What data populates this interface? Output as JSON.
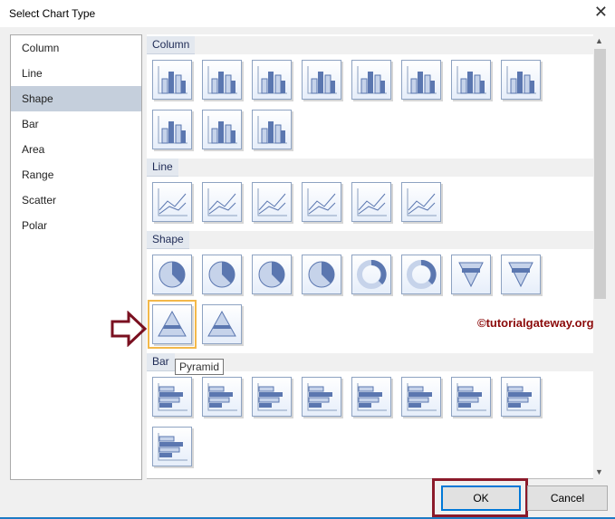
{
  "dialog": {
    "title": "Select Chart Type",
    "close_icon": "close-icon"
  },
  "categories": [
    "Column",
    "Line",
    "Shape",
    "Bar",
    "Area",
    "Range",
    "Scatter",
    "Polar"
  ],
  "selected_category": "Shape",
  "sections": {
    "column": {
      "label": "Column",
      "count": 11
    },
    "line": {
      "label": "Line",
      "count": 6
    },
    "shape": {
      "label": "Shape",
      "count": 10
    },
    "bar": {
      "label": "Bar",
      "count": 9
    }
  },
  "tooltip": "Pyramid",
  "watermark": "©tutorialgateway.org",
  "buttons": {
    "ok": "OK",
    "cancel": "Cancel"
  },
  "colors": {
    "accent": "#5b77b0",
    "selection": "#f3b84a",
    "highlight": "#8b1a2a"
  }
}
